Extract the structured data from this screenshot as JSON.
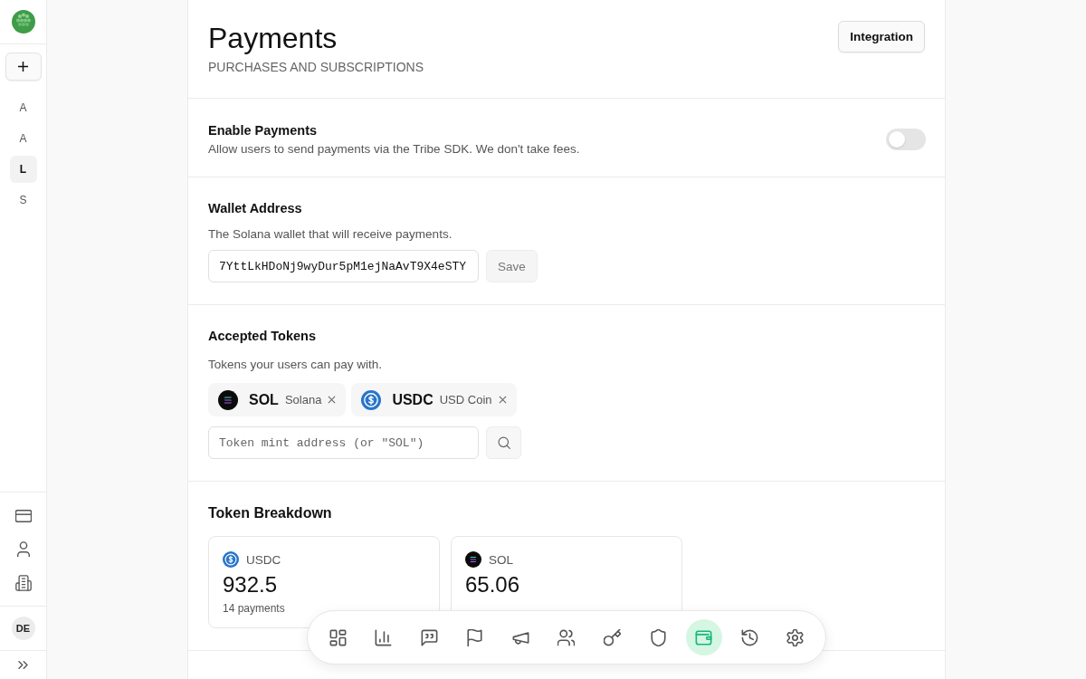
{
  "sidebar": {
    "items": [
      {
        "label": "A",
        "selected": false
      },
      {
        "label": "A",
        "selected": false
      },
      {
        "label": "L",
        "selected": true
      },
      {
        "label": "S",
        "selected": false
      }
    ],
    "avatar": "DE"
  },
  "header": {
    "title": "Payments",
    "subtitle": "PURCHASES AND SUBSCRIPTIONS",
    "button": "Integration"
  },
  "enable": {
    "title": "Enable Payments",
    "description": "Allow users to send payments via the Tribe SDK. We don't take fees.",
    "on": false
  },
  "wallet": {
    "title": "Wallet Address",
    "description": "The Solana wallet that will receive payments.",
    "value": "7YttLkHDoNj9wyDur5pM1ejNaAvT9X4eSTY",
    "button": {
      "label": "Save",
      "disabled": true
    }
  },
  "tokens": {
    "title": "Accepted Tokens",
    "description": "Tokens your users can pay with.",
    "chips": [
      {
        "kind": "sol",
        "symbol": "SOL",
        "name": "Solana"
      },
      {
        "kind": "usdc",
        "symbol": "USDC",
        "name": "USD Coin"
      }
    ],
    "search": {
      "placeholder": "Token mint address (or \"SOL\")"
    }
  },
  "breakdown": {
    "title": "Token Breakdown",
    "cards": [
      {
        "kind": "usdc",
        "symbol": "USDC",
        "amount": "932.5",
        "count": "14 payments"
      },
      {
        "kind": "sol",
        "symbol": "SOL",
        "amount": "65.06"
      }
    ]
  },
  "dock": {
    "items": [
      {
        "kind": "dashboard",
        "selected": false
      },
      {
        "kind": "chart",
        "selected": false
      },
      {
        "kind": "quote",
        "selected": false
      },
      {
        "kind": "flag",
        "selected": false
      },
      {
        "kind": "megaphone",
        "selected": false
      },
      {
        "kind": "users",
        "selected": false
      },
      {
        "kind": "key",
        "selected": false
      },
      {
        "kind": "shield",
        "selected": false
      },
      {
        "kind": "wallet",
        "selected": true
      },
      {
        "kind": "history",
        "selected": false
      },
      {
        "kind": "settings",
        "selected": false
      }
    ]
  }
}
